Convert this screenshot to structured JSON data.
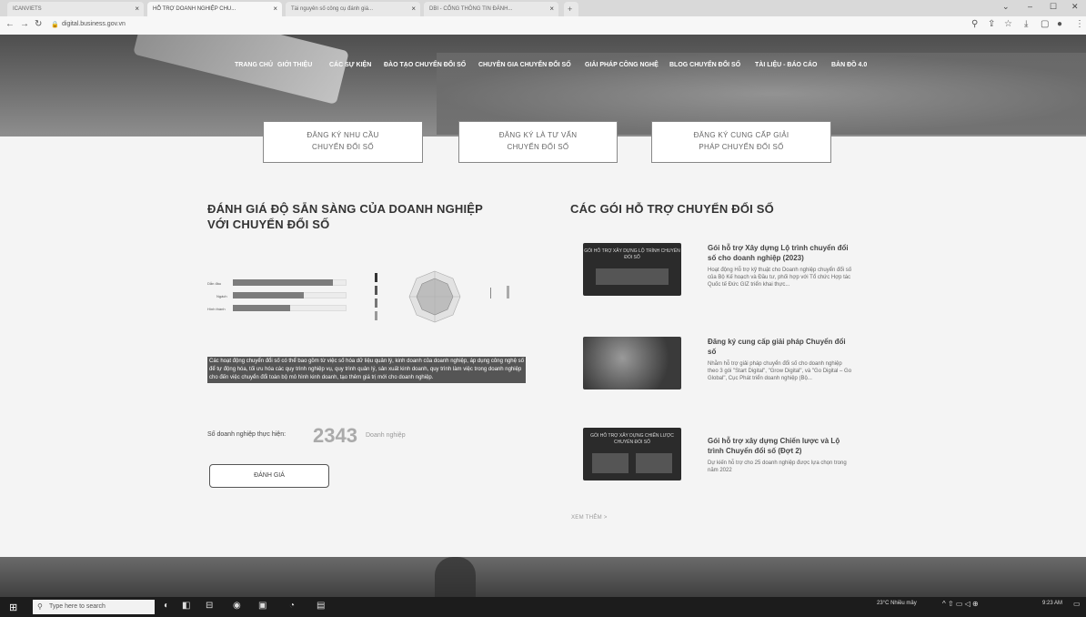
{
  "browser": {
    "tabs": [
      {
        "label": "ICANVIETS"
      },
      {
        "label": "HỖ TRỢ DOANH NGHIỆP CHU..."
      },
      {
        "label": "Tài nguyên số công cụ đánh giá..."
      },
      {
        "label": "DBI - CỔNG THÔNG TIN ĐÁNH..."
      }
    ],
    "new_tab": "+",
    "url": "digital.business.gov.vn"
  },
  "nav": {
    "items": [
      "TRANG CHỦ",
      "GIỚI THIỆU",
      "CÁC SỰ KIỆN",
      "ĐÀO TẠO CHUYỂN ĐỔI SỐ",
      "CHUYÊN GIA CHUYỂN ĐỔI SỐ",
      "GIẢI PHÁP CÔNG NGHỆ",
      "BLOG CHUYỂN ĐỔI SỐ",
      "TÀI LIỆU - BÁO CÁO",
      "BẢN ĐỒ 4.0"
    ]
  },
  "cta": [
    {
      "line1": "ĐĂNG KÝ NHU CẦU",
      "line2": "CHUYỂN ĐỔI SỐ"
    },
    {
      "line1": "ĐĂNG KÝ LÀ TƯ VẤN",
      "line2": "CHUYỂN ĐỔI SỐ"
    },
    {
      "line1": "ĐĂNG KÝ CUNG CẤP GIẢI",
      "line2": "PHÁP CHUYỂN ĐỔI SỐ"
    }
  ],
  "assessment": {
    "title_line1": "ĐÁNH GIÁ ĐỘ SẴN SÀNG CỦA DOANH NGHIỆP",
    "title_line2": "VỚI CHUYỂN ĐỔI SỐ",
    "bars": [
      {
        "label": "Dẫn đầu",
        "level": 0.88
      },
      {
        "label": "Ngách",
        "level": 0.62
      },
      {
        "label": "Hình thành",
        "level": 0.5
      }
    ],
    "description": "Các hoạt động chuyển đổi số có thể bao gồm từ việc số hóa dữ liệu quản lý, kinh doanh của doanh nghiệp, áp dụng công nghệ số để tự động hóa, tối ưu hóa các quy trình nghiệp vụ, quy trình quản lý, sản xuất kinh doanh, quy trình làm việc trong doanh nghiệp cho đến việc chuyển đổi toàn bộ mô hình kinh doanh, tạo thêm giá trị mới cho doanh nghiệp.",
    "count_label": "Số doanh nghiệp thực hiện:",
    "count_value": "2343",
    "count_unit": "Doanh nghiệp",
    "button": "ĐÁNH GIÁ"
  },
  "packages": {
    "title": "CÁC GÓI HỖ TRỢ CHUYỂN ĐỔI SỐ",
    "items": [
      {
        "thumb_text": "GÓI HỖ TRỢ XÂY DỰNG LỘ TRÌNH CHUYỂN ĐỔI SỐ",
        "title": "Gói hỗ trợ Xây dựng Lộ trình chuyển đổi số cho doanh nghiệp (2023)",
        "desc": "Hoạt động Hỗ trợ kỹ thuật cho Doanh nghiệp chuyển đổi số của Bộ Kế hoạch và Đầu tư, phối hợp với Tổ chức Hợp tác Quốc tế Đức GIZ triển khai thực..."
      },
      {
        "thumb_text": "",
        "title": "Đăng ký cung cấp giải pháp Chuyển đổi số",
        "desc": "Nhằm hỗ trợ giải pháp chuyển đổi số cho doanh nghiệp theo 3 gói \"Start Digital\", \"Grow Digital\", và \"Go Digital – Go Global\", Cục Phát triển doanh nghiệp (Bộ..."
      },
      {
        "thumb_text": "GÓI HỖ TRỢ XÂY DỰNG CHIẾN LƯỢC CHUYỂN ĐỔI SỐ",
        "title": "Gói hỗ trợ xây dựng Chiến lược và Lộ trình Chuyển đổi số (Đợt 2)",
        "desc": "Dự kiến hỗ trợ cho 25 doanh nghiệp được lựa chọn trong năm 2022"
      }
    ],
    "more": "XEM THÊM >"
  },
  "taskbar": {
    "search_placeholder": "Type here to search",
    "weather": "23°C Nhiều mây",
    "time": "9:23 AM"
  }
}
